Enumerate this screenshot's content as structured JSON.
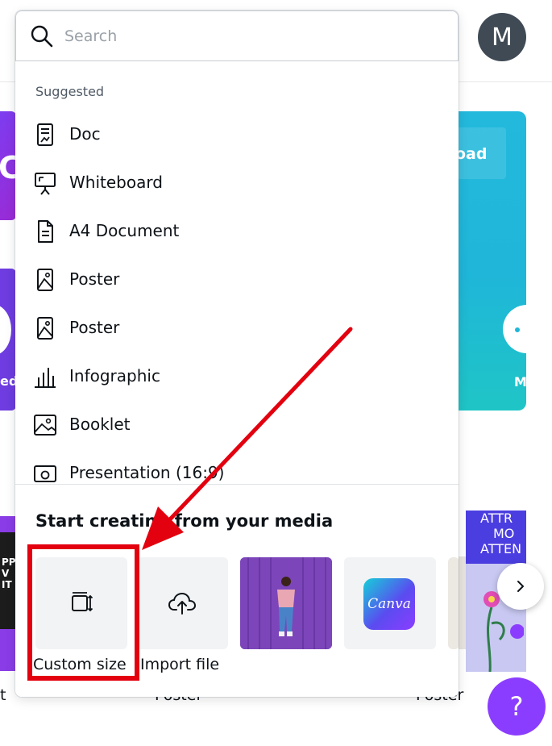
{
  "header": {
    "avatar_initial": "M"
  },
  "search": {
    "placeholder": "Search",
    "value": ""
  },
  "suggested": {
    "title": "Suggested",
    "items": [
      {
        "label": "Doc",
        "icon": "doc-icon"
      },
      {
        "label": "Whiteboard",
        "icon": "whiteboard-icon"
      },
      {
        "label": "A4 Document",
        "icon": "document-icon"
      },
      {
        "label": "Poster",
        "icon": "poster-icon"
      },
      {
        "label": "Poster",
        "icon": "poster-icon"
      },
      {
        "label": "Infographic",
        "icon": "infographic-icon"
      },
      {
        "label": "Booklet",
        "icon": "booklet-icon"
      },
      {
        "label": "Presentation (16:9)",
        "icon": "presentation-icon"
      }
    ]
  },
  "media": {
    "title": "Start creating from your media",
    "tiles": [
      {
        "label": "Custom size",
        "icon": "resize-icon"
      },
      {
        "label": "Import file",
        "icon": "upload-cloud-icon"
      },
      {
        "label": "",
        "icon": "photo-thumbnail"
      },
      {
        "label": "",
        "icon": "canva-logo",
        "logo_text": "Canva"
      }
    ]
  },
  "background": {
    "banner_left_text": "C",
    "banner_left_label": "edi",
    "banner_right_text": "oad",
    "banner_right_label": "M",
    "poster_left_label": "t",
    "poster_mid_label": "Poster",
    "poster_right_label": "Poster",
    "poster_right_title": [
      "ATTR",
      "MO",
      "ATTEN"
    ],
    "help_label": "?"
  },
  "colors": {
    "accent": "#8b3dff",
    "annotation": "#e3000f",
    "teal": "#1fb6d9"
  }
}
